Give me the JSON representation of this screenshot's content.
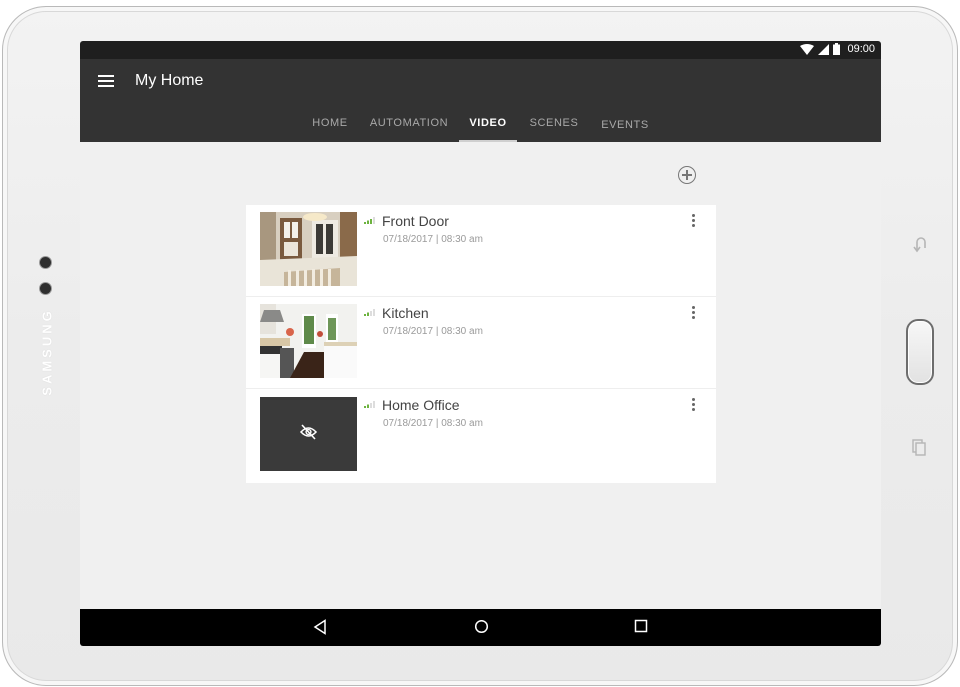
{
  "device": {
    "brand": "SAMSUNG",
    "hardware_buttons": [
      "back-icon",
      "home-button",
      "recent-apps-icon"
    ]
  },
  "statusbar": {
    "time": "09:00",
    "icons": [
      "wifi-icon",
      "cell-signal-icon",
      "battery-icon"
    ]
  },
  "appbar": {
    "title": "My Home",
    "menu_icon": "hamburger-menu-icon"
  },
  "tabs": [
    {
      "label": "HOME",
      "active": false
    },
    {
      "label": "AUTOMATION",
      "active": false
    },
    {
      "label": "VIDEO",
      "active": true
    },
    {
      "label": "SCENES",
      "active": false
    },
    {
      "label": "EVENTS",
      "active": false
    }
  ],
  "actions": {
    "add_icon": "add-circle-icon"
  },
  "cameras": [
    {
      "name": "Front Door",
      "timestamp": "07/18/2017 | 08:30 am",
      "thumbnail": "front-door-snapshot",
      "hidden": false
    },
    {
      "name": "Kitchen",
      "timestamp": "07/18/2017 | 08:30 am",
      "thumbnail": "kitchen-snapshot",
      "hidden": false
    },
    {
      "name": "Home Office",
      "timestamp": "07/18/2017 | 08:30 am",
      "thumbnail": "eye-off-icon",
      "hidden": true
    }
  ],
  "navbar": {
    "buttons": [
      "back-icon",
      "home-icon",
      "recents-icon"
    ]
  },
  "colors": {
    "appbar": "#333333",
    "statusbar": "#1f1f1f",
    "screen_bg": "#f0f0f0",
    "signal_green": "#6db33f",
    "hidden_thumb": "#3a3a3a"
  }
}
